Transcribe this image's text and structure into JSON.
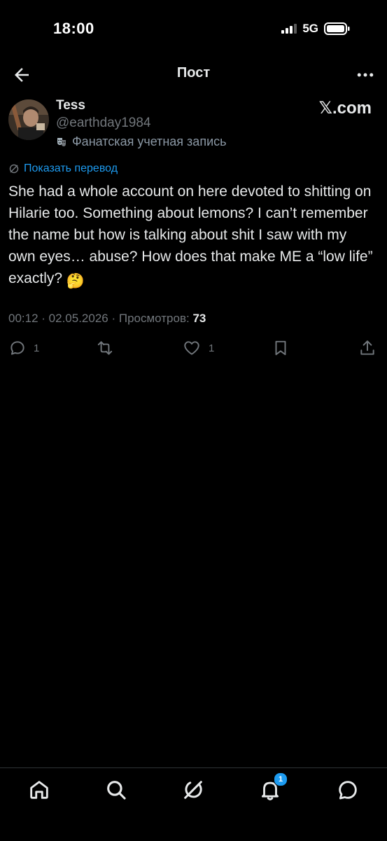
{
  "status_bar": {
    "time": "18:00",
    "network": "5G",
    "icons": [
      "signal-icon",
      "battery-icon"
    ]
  },
  "header": {
    "title": "Пост",
    "icons": [
      "back-arrow-icon",
      "more-icon"
    ]
  },
  "post": {
    "author": {
      "display_name": "Tess",
      "handle": "@earthday1984",
      "fan_label": "Фанатская учетная запись",
      "fan_icon": "theater-masks-icon"
    },
    "watermark": "𝕏.com",
    "translate_label": "Показать перевод",
    "text": "She had a whole account on here devoted to shitting on Hilarie too. Something about lemons? I can’t remember the name but how is talking about shit I saw with my own eyes… abuse? How does that make ME a “low life” exactly? ",
    "emoji": "🤔",
    "meta": {
      "time": "00:12",
      "date": "02.05.2026",
      "views_label": "Просмотров:",
      "views_count": "73",
      "separator": " · "
    },
    "actions": {
      "reply_count": "1",
      "like_count": "1",
      "icons": [
        "reply-icon",
        "repost-icon",
        "like-icon",
        "bookmark-icon",
        "share-icon"
      ]
    }
  },
  "bottom_nav": {
    "items": [
      "home-icon",
      "search-icon",
      "grok-icon",
      "notifications-icon",
      "messages-icon"
    ],
    "notifications_badge": "1"
  },
  "colors": {
    "background": "#000000",
    "text": "#e7e9ea",
    "muted": "#71767b",
    "accent": "#1d9bf0"
  }
}
